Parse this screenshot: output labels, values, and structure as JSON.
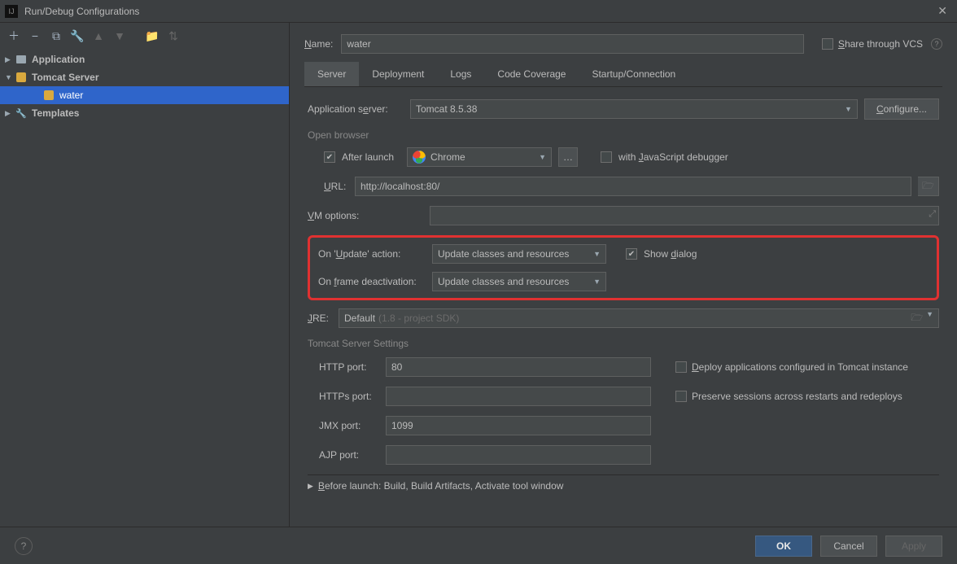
{
  "window": {
    "title": "Run/Debug Configurations"
  },
  "tree": {
    "application": "Application",
    "tomcat_server": "Tomcat Server",
    "water": "water",
    "templates": "Templates"
  },
  "form": {
    "name_label": "Name:",
    "name_value": "water",
    "share_label": "Share through VCS"
  },
  "tabs": {
    "server": "Server",
    "deployment": "Deployment",
    "logs": "Logs",
    "code_coverage": "Code Coverage",
    "startup": "Startup/Connection"
  },
  "server": {
    "app_server_label": "Application server:",
    "app_server_value": "Tomcat 8.5.38",
    "configure": "Configure...",
    "open_browser": "Open browser",
    "after_launch": "After launch",
    "browser": "Chrome",
    "with_js": "with JavaScript debugger",
    "url_label": "URL:",
    "url_value": "http://localhost:80/",
    "vm_label": "VM options:",
    "on_update_label": "On 'Update' action:",
    "on_update_value": "Update classes and resources",
    "show_dialog": "Show dialog",
    "on_frame_label": "On frame deactivation:",
    "on_frame_value": "Update classes and resources",
    "jre_label": "JRE:",
    "jre_value": "Default",
    "jre_hint": "(1.8 - project SDK)",
    "tomcat_settings": "Tomcat Server Settings",
    "http_port_label": "HTTP port:",
    "http_port_value": "80",
    "deploy_label": "Deploy applications configured in Tomcat instance",
    "https_port_label": "HTTPs port:",
    "preserve_label": "Preserve sessions across restarts and redeploys",
    "jmx_port_label": "JMX port:",
    "jmx_port_value": "1099",
    "ajp_port_label": "AJP port:",
    "before_launch": "Before launch: Build, Build Artifacts, Activate tool window"
  },
  "footer": {
    "ok": "OK",
    "cancel": "Cancel",
    "apply": "Apply"
  }
}
